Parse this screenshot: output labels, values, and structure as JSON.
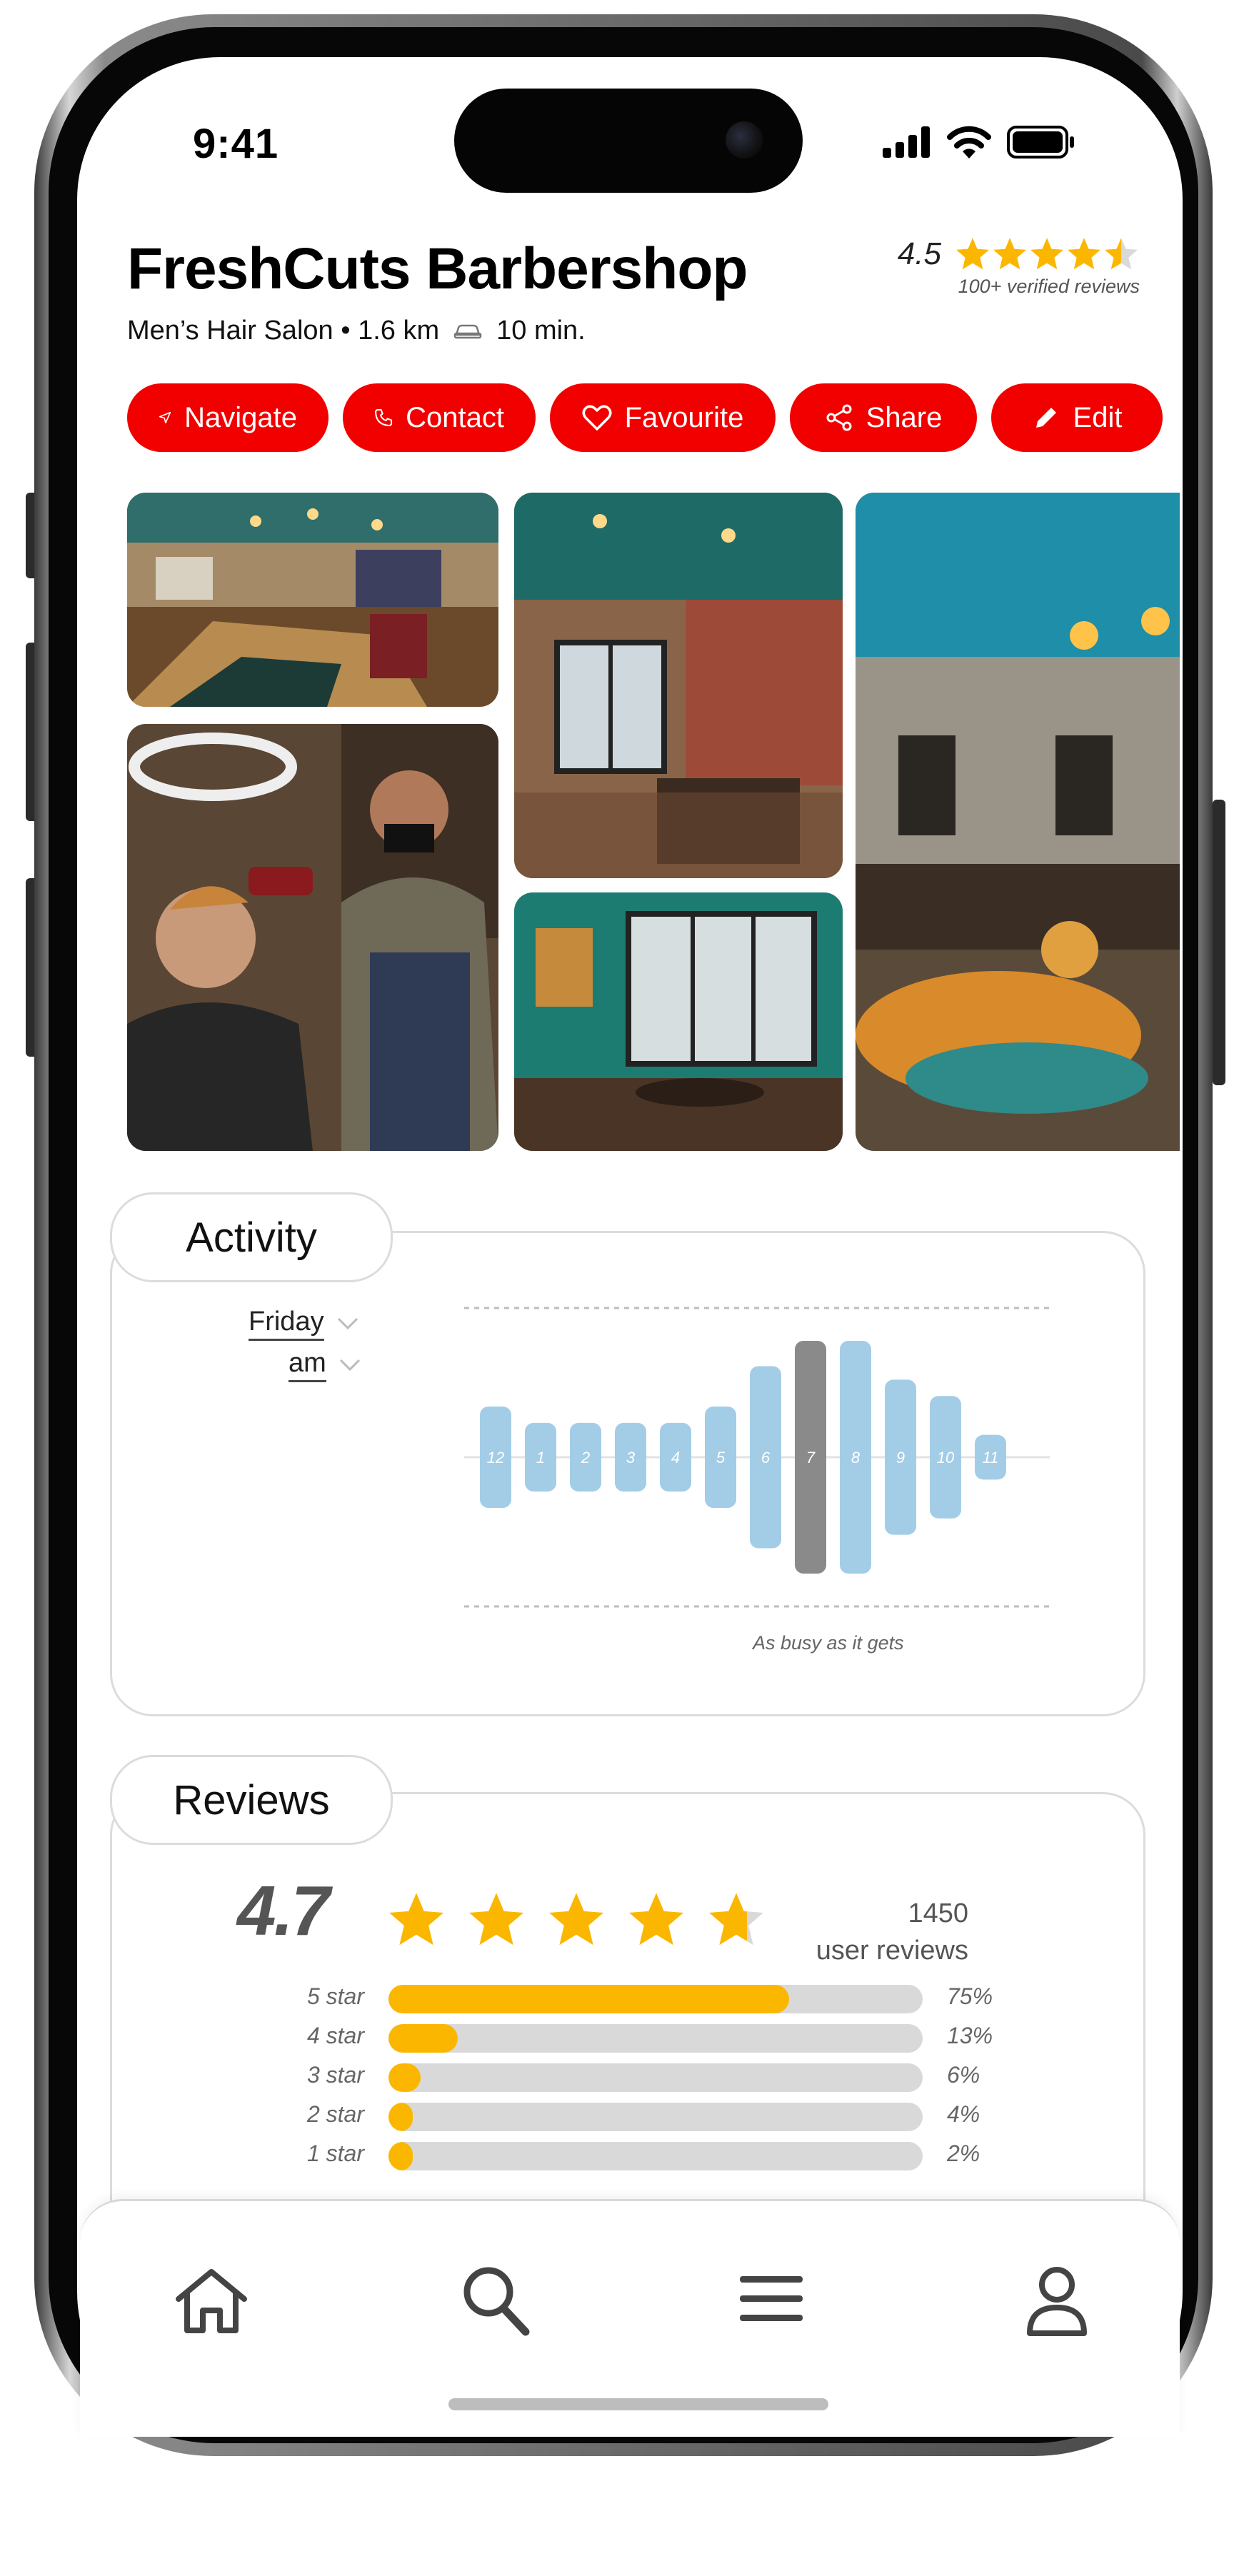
{
  "status_bar": {
    "time": "9:41"
  },
  "business": {
    "name": "FreshCuts Barbershop",
    "category": "Men’s Hair Salon • 1.6 km",
    "drive_time": "10 min.",
    "rating": "4.5",
    "rating_value": 4.5,
    "verified_reviews": "100+ verified reviews"
  },
  "actions": [
    {
      "label": "Navigate",
      "icon": "navigate-arrow-icon"
    },
    {
      "label": "Contact",
      "icon": "phone-icon"
    },
    {
      "label": "Favourite",
      "icon": "heart-icon"
    },
    {
      "label": "Share",
      "icon": "share-icon"
    },
    {
      "label": "Edit",
      "icon": "pencil-icon"
    }
  ],
  "activity": {
    "title": "Activity",
    "day": "Friday",
    "period": "am",
    "caption": "As busy as it gets",
    "chart_data": {
      "type": "bar",
      "categories": [
        "12",
        "1",
        "2",
        "3",
        "4",
        "5",
        "6",
        "7",
        "8",
        "9",
        "10",
        "11"
      ],
      "values": [
        34,
        23,
        23,
        23,
        23,
        34,
        61,
        78,
        78,
        52,
        41,
        15
      ],
      "highlight_index": 7,
      "ylim": [
        0,
        100
      ],
      "colors": {
        "bar": "#a3cde7",
        "highlight": "#8a8a8a"
      }
    }
  },
  "reviews": {
    "title": "Reviews",
    "average": "4.7",
    "average_value": 4.7,
    "count": "1450",
    "count_label": "user reviews",
    "distribution": [
      {
        "label": "5 star",
        "percent": "75%",
        "value": 75
      },
      {
        "label": "4 star",
        "percent": "13%",
        "value": 13
      },
      {
        "label": "3 star",
        "percent": "6%",
        "value": 6
      },
      {
        "label": "2 star",
        "percent": "4%",
        "value": 4
      },
      {
        "label": "1 star",
        "percent": "2%",
        "value": 2
      }
    ]
  },
  "tab_bar": {
    "items": [
      "home-icon",
      "search-icon",
      "menu-icon",
      "profile-icon"
    ]
  },
  "colors": {
    "accent": "#f20000",
    "star": "#fbb700",
    "track": "#d9d9d9"
  }
}
